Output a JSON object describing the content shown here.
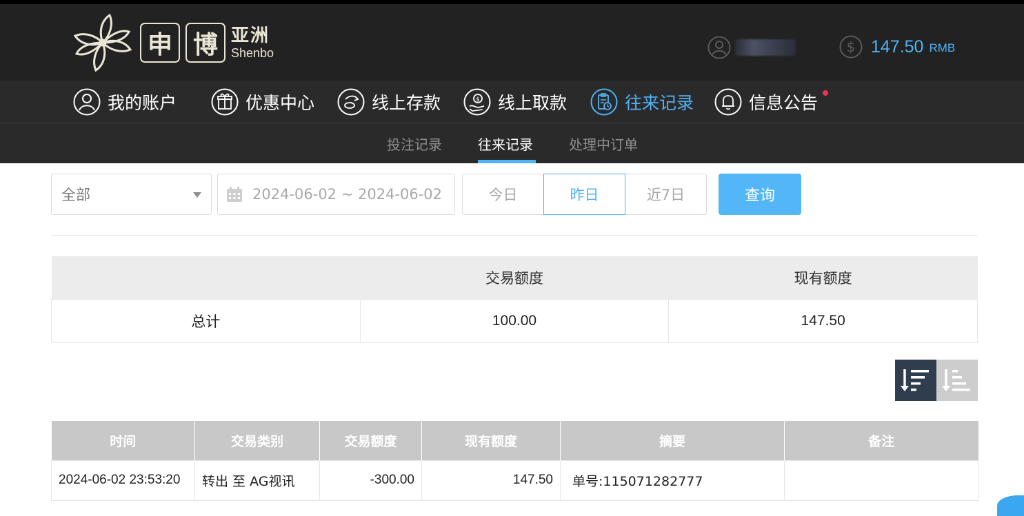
{
  "brand": {
    "logo_box_1": "申",
    "logo_box_2": "博",
    "logo_cn": "亚洲",
    "logo_en": "Shenbo"
  },
  "account": {
    "balance": "147.50",
    "currency": "RMB",
    "accent_color": "#4fb3f6"
  },
  "nav": {
    "items": [
      {
        "label": "我的账户",
        "icon": "user-icon"
      },
      {
        "label": "优惠中心",
        "icon": "gift-icon"
      },
      {
        "label": "线上存款",
        "icon": "deposit-icon"
      },
      {
        "label": "线上取款",
        "icon": "withdraw-icon"
      },
      {
        "label": "往来记录",
        "icon": "records-icon",
        "active": true
      },
      {
        "label": "信息公告",
        "icon": "bell-icon",
        "badge": "red-dot"
      }
    ]
  },
  "subnav": {
    "items": [
      {
        "label": "投注记录"
      },
      {
        "label": "往来记录",
        "active": true
      },
      {
        "label": "处理中订单"
      }
    ]
  },
  "filter": {
    "type_selected": "全部",
    "date_range": "2024-06-02 ~ 2024-06-02",
    "quick_ranges": [
      "今日",
      "昨日",
      "近7日"
    ],
    "quick_selected": "昨日",
    "search_label": "查询"
  },
  "summary": {
    "headers": [
      "",
      "交易额度",
      "现有额度"
    ],
    "row": {
      "label": "总计",
      "transaction": "100.00",
      "available": "147.50"
    }
  },
  "sort": {
    "selected": "desc",
    "options": [
      "sort-desc-icon",
      "sort-asc-icon"
    ]
  },
  "records": {
    "headers": [
      "时间",
      "交易类别",
      "交易额度",
      "现有额度",
      "摘要",
      "备注"
    ],
    "rows": [
      {
        "time": "2024-06-02 23:53:20",
        "type": "转出 至 AG视讯",
        "amount": "-300.00",
        "balance": "147.50",
        "summary": "单号:115071282777",
        "note": ""
      }
    ]
  }
}
